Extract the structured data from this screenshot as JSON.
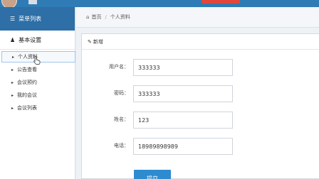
{
  "sidebar": {
    "header": {
      "icon": "list-icon",
      "label": "菜单列表"
    },
    "section": {
      "icon": "user-icon",
      "label": "基本设置"
    },
    "items": [
      {
        "label": "个人资料",
        "active": true
      },
      {
        "label": "公告查看"
      },
      {
        "label": "会议预约"
      },
      {
        "label": "我的会议"
      },
      {
        "label": "会议列表"
      }
    ]
  },
  "breadcrumb": {
    "home": "首页",
    "current": "个人资料"
  },
  "panel": {
    "title": "新增",
    "icon": "edit-icon"
  },
  "form": {
    "username": {
      "label": "用户名：",
      "value": "333333"
    },
    "password": {
      "label": "密码：",
      "value": "333333"
    },
    "name": {
      "label": "姓名：",
      "value": "123"
    },
    "phone": {
      "label": "电话：",
      "value": "18989898989"
    },
    "submit_label": "提交"
  },
  "colors": {
    "accent": "#2d6fa6",
    "button": "#2e8bd0",
    "alert": "#e2473b"
  }
}
